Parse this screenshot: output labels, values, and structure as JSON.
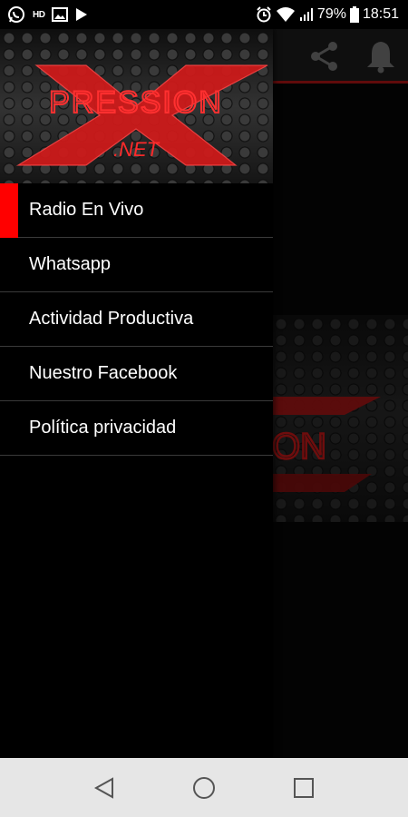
{
  "status_bar": {
    "battery": "79%",
    "time": "18:51",
    "left_icons": [
      "whatsapp-icon",
      "hd-icon",
      "gallery-icon",
      "play-icon"
    ],
    "right_icons": [
      "alarm-icon",
      "wifi-icon",
      "signal-icon",
      "battery-icon"
    ],
    "hd_label": "HD"
  },
  "toolbar": {
    "icons": [
      "share-icon",
      "bell-icon"
    ]
  },
  "drawer": {
    "logo": {
      "letter": "X",
      "word": "PRESSION",
      "suffix": ".NET"
    },
    "items": [
      {
        "label": "Radio En Vivo",
        "active": true
      },
      {
        "label": "Whatsapp",
        "active": false
      },
      {
        "label": "Actividad Productiva",
        "active": false
      },
      {
        "label": "Nuestro Facebook",
        "active": false
      },
      {
        "label": "Política privacidad",
        "active": false
      }
    ]
  },
  "navbar": {
    "icons": [
      "back-icon",
      "home-icon",
      "recents-icon"
    ]
  },
  "colors": {
    "accent": "#ff0000",
    "logo_red": "#d11a1a",
    "toolbar_border": "#b01515",
    "navbar": "#e6e6e6"
  }
}
